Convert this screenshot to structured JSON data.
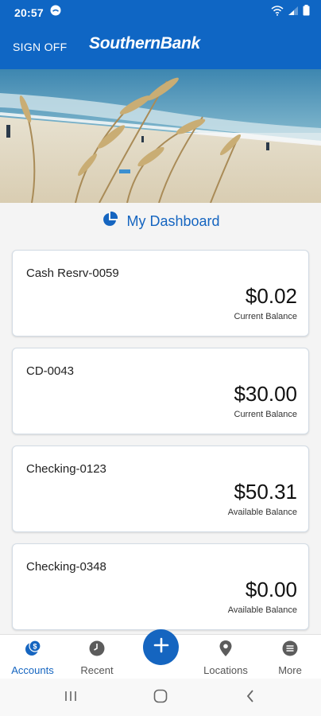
{
  "status_bar": {
    "time": "20:57"
  },
  "header": {
    "sign_off_label": "SIGN OFF",
    "brand": "SouthernBank"
  },
  "dashboard": {
    "title": "My Dashboard"
  },
  "accounts": [
    {
      "name": "Cash Resrv-0059",
      "amount": "$0.02",
      "balance_label": "Current Balance"
    },
    {
      "name": "CD-0043",
      "amount": "$30.00",
      "balance_label": "Current Balance"
    },
    {
      "name": "Checking-0123",
      "amount": "$50.31",
      "balance_label": "Available Balance"
    },
    {
      "name": "Checking-0348",
      "amount": "$0.00",
      "balance_label": "Available Balance"
    }
  ],
  "tab_bar": {
    "tabs": [
      {
        "label": "Accounts",
        "icon": "dollar-coin-icon",
        "active": true
      },
      {
        "label": "Recent",
        "icon": "clock-icon"
      },
      {
        "label": "Locations",
        "icon": "map-pin-icon"
      },
      {
        "label": "More",
        "icon": "menu-circle-icon"
      }
    ]
  },
  "colors": {
    "brand_blue": "#0f66c4",
    "accent_blue": "#1565c0"
  }
}
